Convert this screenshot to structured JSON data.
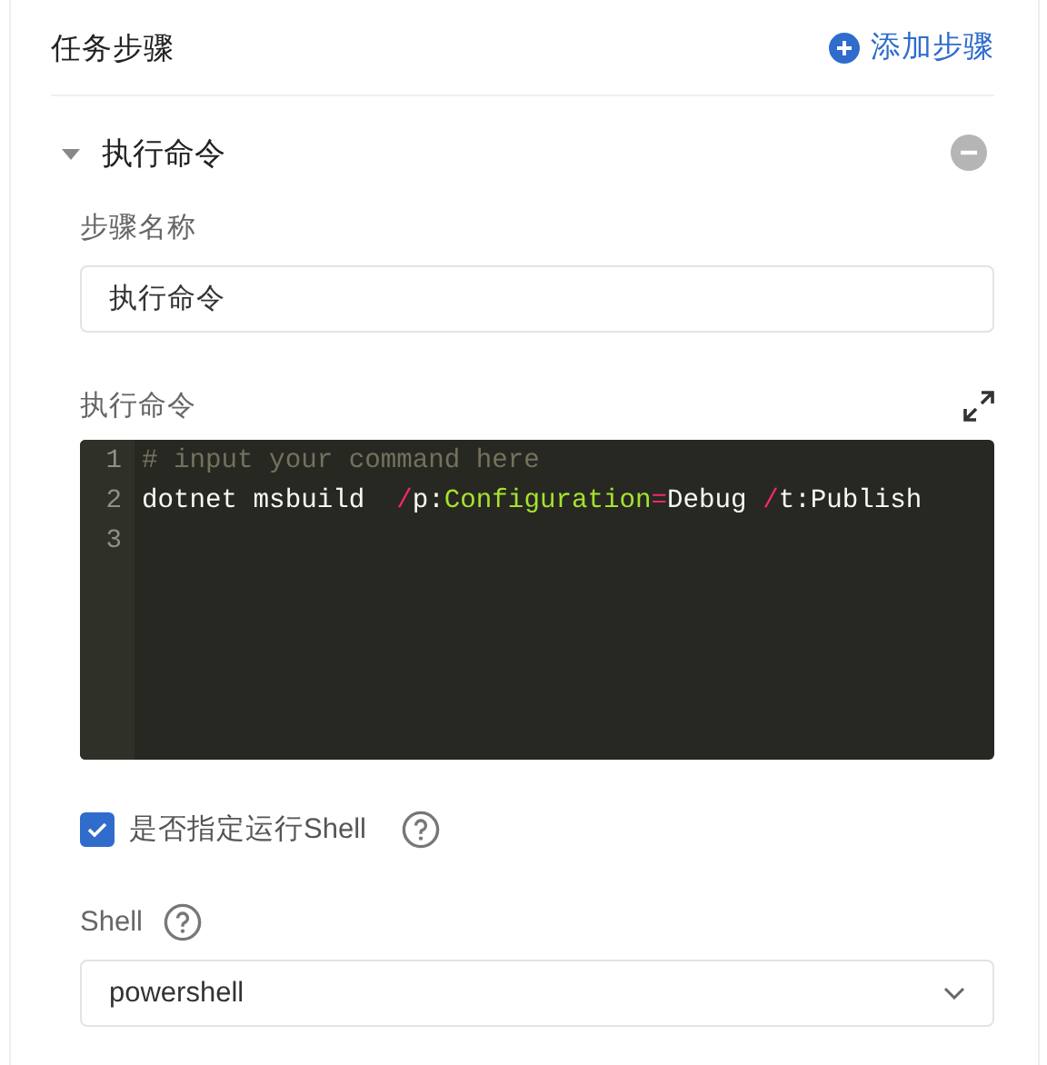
{
  "section": {
    "title": "任务步骤",
    "add_button": "添加步骤"
  },
  "step": {
    "title": "执行命令",
    "expanded": true,
    "name_field": {
      "label": "步骤名称",
      "value": "执行命令"
    },
    "command": {
      "label": "执行命令",
      "lines": [
        {
          "number": "1",
          "tokens": [
            {
              "kind": "comment",
              "text": "# input your command here"
            }
          ]
        },
        {
          "number": "2",
          "tokens": [
            {
              "kind": "plain",
              "text": "dotnet msbuild  "
            },
            {
              "kind": "operator",
              "text": "/"
            },
            {
              "kind": "plain",
              "text": "p:"
            },
            {
              "kind": "attribute",
              "text": "Configuration"
            },
            {
              "kind": "operator",
              "text": "="
            },
            {
              "kind": "plain",
              "text": "Debug "
            },
            {
              "kind": "operator",
              "text": "/"
            },
            {
              "kind": "plain",
              "text": "t:Publish"
            }
          ]
        },
        {
          "number": "3"
        }
      ]
    },
    "shell_option": {
      "label": "是否指定运行Shell",
      "checked": true
    },
    "shell_select": {
      "label": "Shell",
      "value": "powershell"
    }
  }
}
